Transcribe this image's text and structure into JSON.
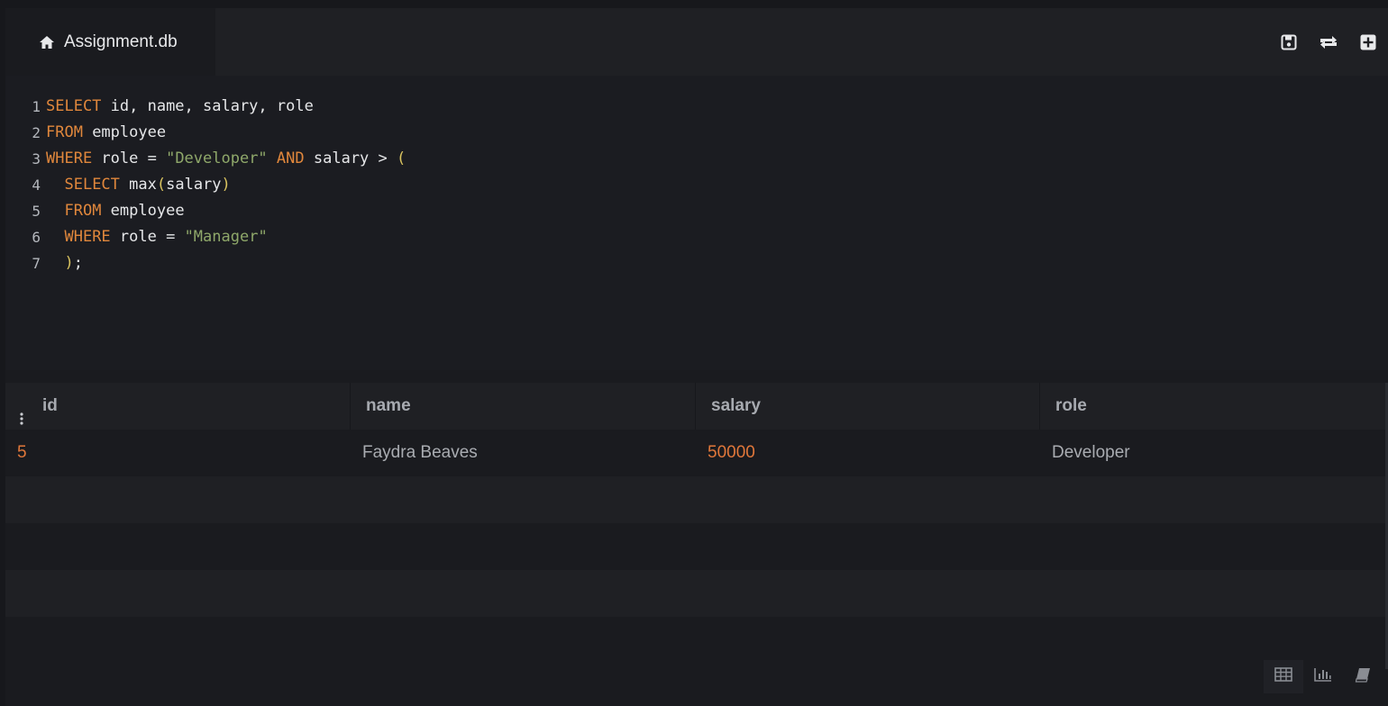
{
  "tab": {
    "label": "Assignment.db",
    "icon": "home-icon"
  },
  "toolbar": {
    "buttons": [
      {
        "name": "save",
        "icon": "save-icon"
      },
      {
        "name": "refresh",
        "icon": "refresh-icon"
      },
      {
        "name": "add",
        "icon": "plus-square-icon"
      }
    ]
  },
  "editor": {
    "lines": [
      {
        "n": "1",
        "tokens": [
          [
            "kw",
            "SELECT"
          ],
          [
            "id",
            " id, name, salary, role"
          ]
        ]
      },
      {
        "n": "2",
        "tokens": [
          [
            "kw",
            "FROM"
          ],
          [
            "id",
            " employee"
          ]
        ]
      },
      {
        "n": "3",
        "tokens": [
          [
            "kw",
            "WHERE"
          ],
          [
            "id",
            " role = "
          ],
          [
            "str",
            "\"Developer\""
          ],
          [
            "id",
            " "
          ],
          [
            "kw",
            "AND"
          ],
          [
            "id",
            " salary > "
          ],
          [
            "paren",
            "("
          ]
        ]
      },
      {
        "n": "4",
        "tokens": [
          [
            "id",
            "  "
          ],
          [
            "kw",
            "SELECT"
          ],
          [
            "id",
            " max"
          ],
          [
            "paren",
            "("
          ],
          [
            "id",
            "salary"
          ],
          [
            "paren",
            ")"
          ]
        ]
      },
      {
        "n": "5",
        "tokens": [
          [
            "id",
            "  "
          ],
          [
            "kw",
            "FROM"
          ],
          [
            "id",
            " employee"
          ]
        ]
      },
      {
        "n": "6",
        "tokens": [
          [
            "id",
            "  "
          ],
          [
            "kw",
            "WHERE"
          ],
          [
            "id",
            " role = "
          ],
          [
            "str",
            "\"Manager\""
          ]
        ]
      },
      {
        "n": "7",
        "tokens": [
          [
            "id",
            "  "
          ],
          [
            "paren",
            ")"
          ],
          [
            "id",
            ";"
          ]
        ]
      }
    ]
  },
  "results": {
    "columns": [
      "id",
      "name",
      "salary",
      "role"
    ],
    "rows": [
      [
        "5",
        "Faydra Beaves",
        "50000",
        "Developer"
      ]
    ],
    "numeric_columns": [
      0,
      2
    ]
  },
  "view_switch": {
    "buttons": [
      {
        "name": "table",
        "icon": "table-icon",
        "active": true
      },
      {
        "name": "chart",
        "icon": "bar-chart-icon",
        "active": false
      },
      {
        "name": "docs",
        "icon": "book-icon",
        "active": false
      }
    ]
  },
  "colors": {
    "keyword": "#e0873c",
    "string": "#8fa86a",
    "paren": "#d9c35f",
    "number": "#e0773a"
  }
}
